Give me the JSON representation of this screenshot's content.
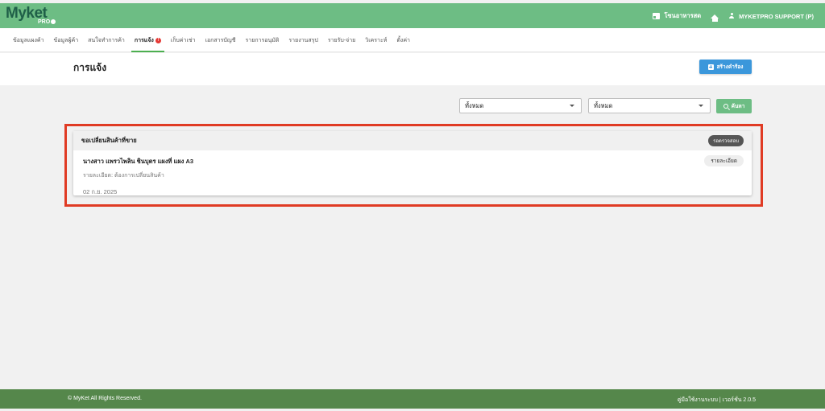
{
  "brand": {
    "name": "Myket",
    "sub": "PRO"
  },
  "topbar": {
    "store_label": "โซนอาหารสด",
    "user_label": "MYKETPRO SUPPORT (P)"
  },
  "nav": {
    "tabs": [
      {
        "label": "ข้อมูลแผงค้า",
        "active": false
      },
      {
        "label": "ข้อมูลผู้ค้า",
        "active": false
      },
      {
        "label": "สนใจทำการค้า",
        "active": false
      },
      {
        "label": "การแจ้ง",
        "active": true,
        "badge": "!"
      },
      {
        "label": "เก็บค่าเช่า",
        "active": false
      },
      {
        "label": "เอกสารบัญชี",
        "active": false
      },
      {
        "label": "รายการอนุมัติ",
        "active": false
      },
      {
        "label": "รายงานสรุป",
        "active": false
      },
      {
        "label": "รายรับ-จ่าย",
        "active": false
      },
      {
        "label": "วิเคราะห์",
        "active": false
      },
      {
        "label": "ตั้งค่า",
        "active": false
      }
    ]
  },
  "header": {
    "title": "การแจ้ง",
    "create_button": "สร้างคำร้อง"
  },
  "filters": {
    "select1": "ทั้งหมด",
    "select2": "ทั้งหมด",
    "search_button": "ค้นหา"
  },
  "request": {
    "title": "ขอเปลี่ยนสินค้าที่ขาย",
    "status": "รอตรวจสอบ",
    "customer": "นางสาว แพรวไพลิน ชินบุตร แผงที่ แผง A3",
    "detail": "รายละเอียด: ต้องการเปลี่ยนสินค้า",
    "date": "02 ก.ย. 2025",
    "detail_button": "รายละเอียด"
  },
  "footer": {
    "copyright": "© MyKet All Rights Reserved.",
    "manual": "คู่มือใช้งานระบบ | เวอร์ชั่น 2.0.5"
  },
  "colors": {
    "primary_green": "#6dbd84",
    "footer_green": "#55874b",
    "accent_blue": "#3b97db",
    "highlight_red": "#e03b24"
  }
}
